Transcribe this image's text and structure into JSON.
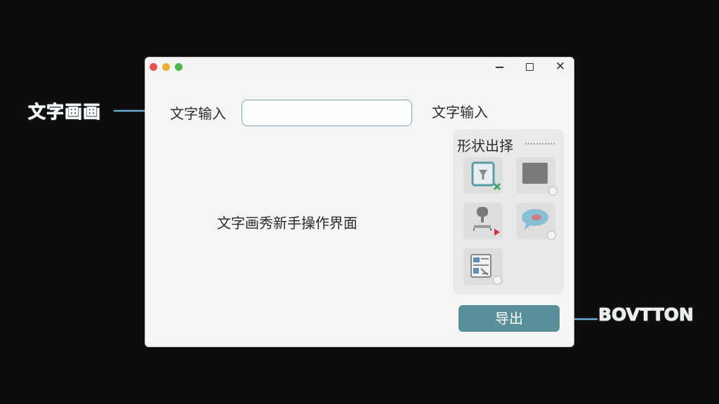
{
  "annotations": {
    "left_label": "文字画画",
    "right_label": "BOVTTON"
  },
  "window": {
    "controls": {
      "close": "✕"
    }
  },
  "form": {
    "input_label": "文字输入",
    "input_value": "",
    "input_label_right": "文字输入"
  },
  "main": {
    "center_text": "文字画秀新手操作界面"
  },
  "shape_panel": {
    "title": "形状出择",
    "shapes": [
      {
        "icon": "image-frame-icon"
      },
      {
        "icon": "square-icon"
      },
      {
        "icon": "stamp-icon"
      },
      {
        "icon": "speech-bubble-icon"
      },
      {
        "icon": "document-icon"
      }
    ]
  },
  "export_button": {
    "label": "导出"
  },
  "colors": {
    "accent": "#5a8e9a",
    "input_border": "#7aa3b5",
    "annotation_arrow": "#6aaed6"
  }
}
